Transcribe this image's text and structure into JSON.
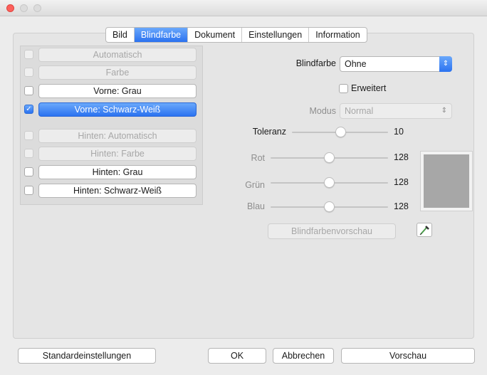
{
  "tabs": [
    "Bild",
    "Blindfarbe",
    "Dokument",
    "Einstellungen",
    "Information"
  ],
  "left_list": [
    {
      "label": "Automatisch",
      "enabled": false,
      "selected": false,
      "checked": false
    },
    {
      "label": "Farbe",
      "enabled": false,
      "selected": false,
      "checked": false
    },
    {
      "label": "Vorne: Grau",
      "enabled": true,
      "selected": false,
      "checked": false
    },
    {
      "label": "Vorne: Schwarz-Weiß",
      "enabled": true,
      "selected": true,
      "checked": true
    },
    {
      "label": "Hinten: Automatisch",
      "enabled": false,
      "selected": false,
      "checked": false
    },
    {
      "label": "Hinten: Farbe",
      "enabled": false,
      "selected": false,
      "checked": false
    },
    {
      "label": "Hinten: Grau",
      "enabled": true,
      "selected": false,
      "checked": false
    },
    {
      "label": "Hinten: Schwarz-Weiß",
      "enabled": true,
      "selected": false,
      "checked": false
    }
  ],
  "blindfarbe": {
    "label": "Blindfarbe",
    "value": "Ohne"
  },
  "erweitert": {
    "label": "Erweitert",
    "checked": false
  },
  "modus": {
    "label": "Modus",
    "value": "Normal"
  },
  "sliders": {
    "toleranz": {
      "label": "Toleranz",
      "value": "10",
      "fraction": 0.5
    },
    "rot": {
      "label": "Rot",
      "value": "128",
      "fraction": 0.5
    },
    "gruen": {
      "label": "Grün",
      "value": "128",
      "fraction": 0.5
    },
    "blau": {
      "label": "Blau",
      "value": "128",
      "fraction": 0.5
    }
  },
  "preview_color": "#a7a7a7",
  "buttons": {
    "vorschau_blind": "Blindfarbenvorschau",
    "standard": "Standardeinstellungen",
    "ok": "OK",
    "abbrechen": "Abbrechen",
    "vorschau": "Vorschau"
  },
  "colors": {
    "accent": "#2b72f0"
  }
}
